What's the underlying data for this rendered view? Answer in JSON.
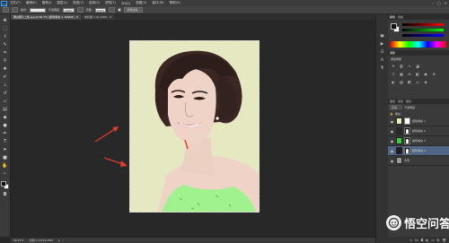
{
  "menubar": {
    "logo": "Ps",
    "items": [
      "文件(F)",
      "编辑(E)",
      "图像(I)",
      "图层(L)",
      "类型(Y)",
      "选择(S)",
      "滤镜(T)",
      "3D(D)",
      "视图(V)",
      "窗口(W)",
      "帮助(H)"
    ],
    "window_controls": [
      "–",
      "□",
      "✕"
    ]
  },
  "options": {
    "field1": "100%",
    "field2": "100%",
    "label1": "模式:",
    "label2": "不透明度:",
    "label3": "流量:",
    "button1": "调整边缘..."
  },
  "tabs": [
    {
      "label": "黑白照片上色.jpg @ 66.7% (颜色填充 1, RGB/8)",
      "active": true
    },
    {
      "label": "未标题-1 @ 100%",
      "active": false
    }
  ],
  "statusbar": {
    "zoom": "66.67%",
    "doc": "文档:1.41M/6.28M"
  },
  "panels": {
    "color_tabs": [
      "颜色",
      "色板"
    ],
    "adjust_title": "调整",
    "adjust_add_label": "添加调整",
    "layers_tabs": [
      "图层",
      "通道",
      "路径"
    ],
    "blend_mode": "正常",
    "opacity_label": "不透明度:",
    "fill_label": "填充:",
    "layers": [
      {
        "name": "颜色填充 1",
        "thumb_color": "#ecefb0",
        "selected": false,
        "mask": "white"
      },
      {
        "name": "颜色填充 2",
        "thumb_color": "#2a2a2a",
        "selected": false,
        "mask": "figure"
      },
      {
        "name": "颜色填充 3",
        "thumb_color": "#3ad134",
        "selected": false,
        "mask": "figure"
      },
      {
        "name": "颜色填充 4",
        "thumb_color": "#1e1e1e",
        "selected": true,
        "mask": "figure"
      },
      {
        "name": "背景",
        "thumb_color": "#9a9a9a",
        "selected": false,
        "mask": "none"
      }
    ]
  },
  "watermark": {
    "text": "悟空问答"
  },
  "colors": {
    "canvas_bg": "#282828",
    "doc_bg": "#e6e8c2",
    "selection": "#506685",
    "arrow": "#e23b2f"
  }
}
